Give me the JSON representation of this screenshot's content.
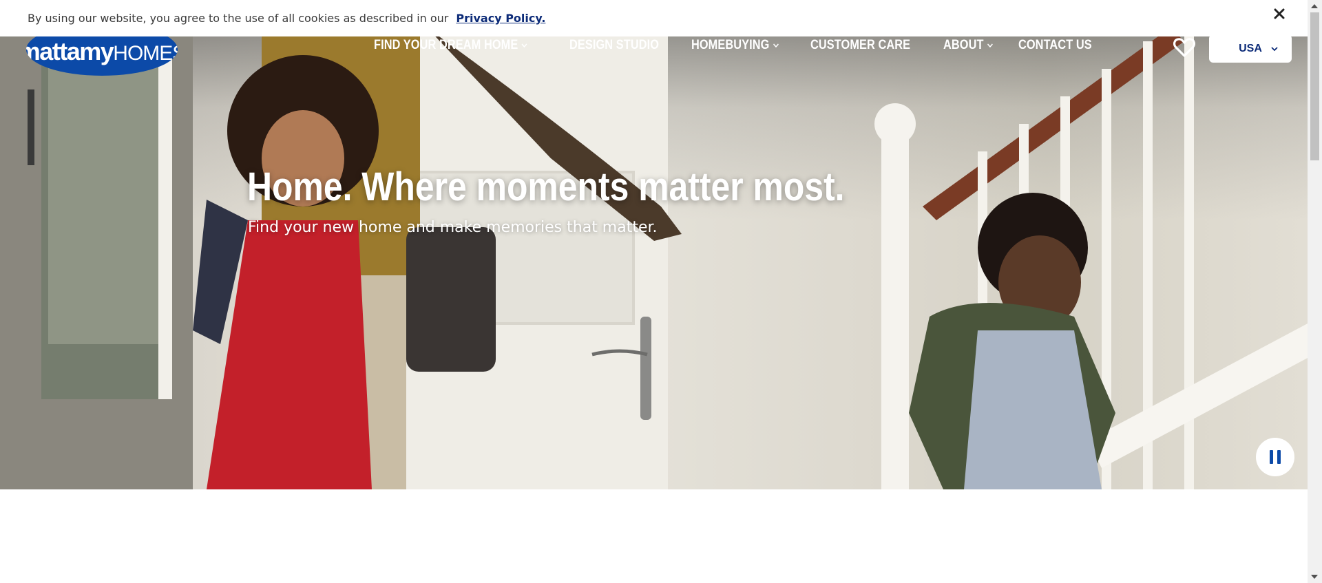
{
  "cookie_banner": {
    "text": "By using our website, you agree to the use of all cookies as described in our",
    "link": "Privacy Policy."
  },
  "header": {
    "logo_bold": "mattamy",
    "logo_light": "HOMES",
    "nav": [
      {
        "label": "FIND YOUR DREAM HOME",
        "dropdown": true
      },
      {
        "label": "DESIGN STUDIO",
        "dropdown": false
      },
      {
        "label": "HOMEBUYING",
        "dropdown": true
      },
      {
        "label": "CUSTOMER CARE",
        "dropdown": false
      },
      {
        "label": "ABOUT",
        "dropdown": true
      },
      {
        "label": "CONTACT US",
        "dropdown": false
      }
    ],
    "country": "USA"
  },
  "hero": {
    "title": "Home. Where moments matter most.",
    "subtitle": "Find your new home and make memories that matter."
  },
  "colors": {
    "brand_blue": "#0c4aa8",
    "link_navy": "#0c2b78"
  },
  "icons": [
    "close-icon",
    "heart-icon",
    "chevron-down-icon",
    "pause-icon"
  ]
}
